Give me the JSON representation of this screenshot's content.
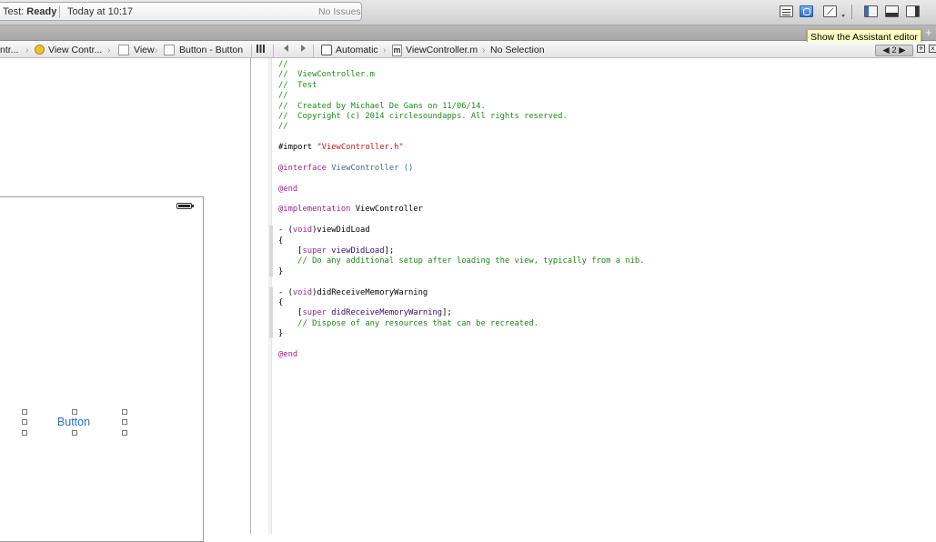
{
  "toolbar": {
    "status": {
      "scheme_label": "Test:",
      "state": "Ready",
      "timestamp": "Today at 10:17",
      "issues": "No Issues"
    },
    "editor_buttons": [
      "standard-editor",
      "assistant-editor",
      "version-editor"
    ],
    "view_buttons": [
      "navigator",
      "debug-area",
      "utilities"
    ],
    "accent_color": "#2d6fc0"
  },
  "tooltip": {
    "text": "Show the Assistant editor"
  },
  "tabstrip": {
    "add_label": "+"
  },
  "jumpbar": {
    "left_path": [
      "ntr...",
      "View Contr...",
      "View",
      "Button - Button"
    ],
    "mode": "Automatic",
    "file": "ViewController.m",
    "selection": "No Selection",
    "pager": "◀ 2 ▶",
    "add_label": "+",
    "close_label": "×"
  },
  "canvas": {
    "button_label": "Button",
    "button_color": "#2e6fd0"
  },
  "code": {
    "lines": [
      {
        "t": "//",
        "c": "c-com"
      },
      {
        "t": "//  ViewController.m",
        "c": "c-com"
      },
      {
        "t": "//  Test",
        "c": "c-com"
      },
      {
        "t": "//",
        "c": "c-com"
      },
      {
        "t": "//  Created by Michael De Gans on 11/06/14.",
        "c": "c-com"
      },
      {
        "t": "//  Copyright (c) 2014 circlesoundapps. All rights reserved.",
        "c": "c-com"
      },
      {
        "t": "//",
        "c": "c-com"
      },
      {
        "t": "",
        "c": ""
      },
      {
        "parts": [
          {
            "t": "#import ",
            "c": ""
          },
          {
            "t": "\"ViewController.h\"",
            "c": "c-str"
          }
        ]
      },
      {
        "t": "",
        "c": ""
      },
      {
        "parts": [
          {
            "t": "@interface ",
            "c": "c-key"
          },
          {
            "t": "ViewController ()",
            "c": "c-cls"
          }
        ]
      },
      {
        "t": "",
        "c": ""
      },
      {
        "t": "@end",
        "c": "c-key"
      },
      {
        "t": "",
        "c": ""
      },
      {
        "parts": [
          {
            "t": "@implementation ",
            "c": "c-key"
          },
          {
            "t": "ViewController",
            "c": ""
          }
        ]
      },
      {
        "t": "",
        "c": ""
      },
      {
        "parts": [
          {
            "t": "- (",
            "c": ""
          },
          {
            "t": "void",
            "c": "c-key"
          },
          {
            "t": ")viewDidLoad",
            "c": ""
          }
        ]
      },
      {
        "t": "{",
        "c": ""
      },
      {
        "parts": [
          {
            "t": "    [",
            "c": ""
          },
          {
            "t": "super",
            "c": "c-key"
          },
          {
            "t": " ",
            "c": ""
          },
          {
            "t": "viewDidLoad",
            "c": "c-mth"
          },
          {
            "t": "];",
            "c": ""
          }
        ]
      },
      {
        "t": "    // Do any additional setup after loading the view, typically from a nib.",
        "c": "c-com"
      },
      {
        "t": "}",
        "c": ""
      },
      {
        "t": "",
        "c": ""
      },
      {
        "parts": [
          {
            "t": "- (",
            "c": ""
          },
          {
            "t": "void",
            "c": "c-key"
          },
          {
            "t": ")didReceiveMemoryWarning",
            "c": ""
          }
        ]
      },
      {
        "t": "{",
        "c": ""
      },
      {
        "parts": [
          {
            "t": "    [",
            "c": ""
          },
          {
            "t": "super",
            "c": "c-key"
          },
          {
            "t": " ",
            "c": ""
          },
          {
            "t": "didReceiveMemoryWarning",
            "c": "c-mth"
          },
          {
            "t": "];",
            "c": ""
          }
        ]
      },
      {
        "t": "    // Dispose of any resources that can be recreated.",
        "c": "c-com"
      },
      {
        "t": "}",
        "c": ""
      },
      {
        "t": "",
        "c": ""
      },
      {
        "t": "@end",
        "c": "c-key"
      }
    ]
  }
}
